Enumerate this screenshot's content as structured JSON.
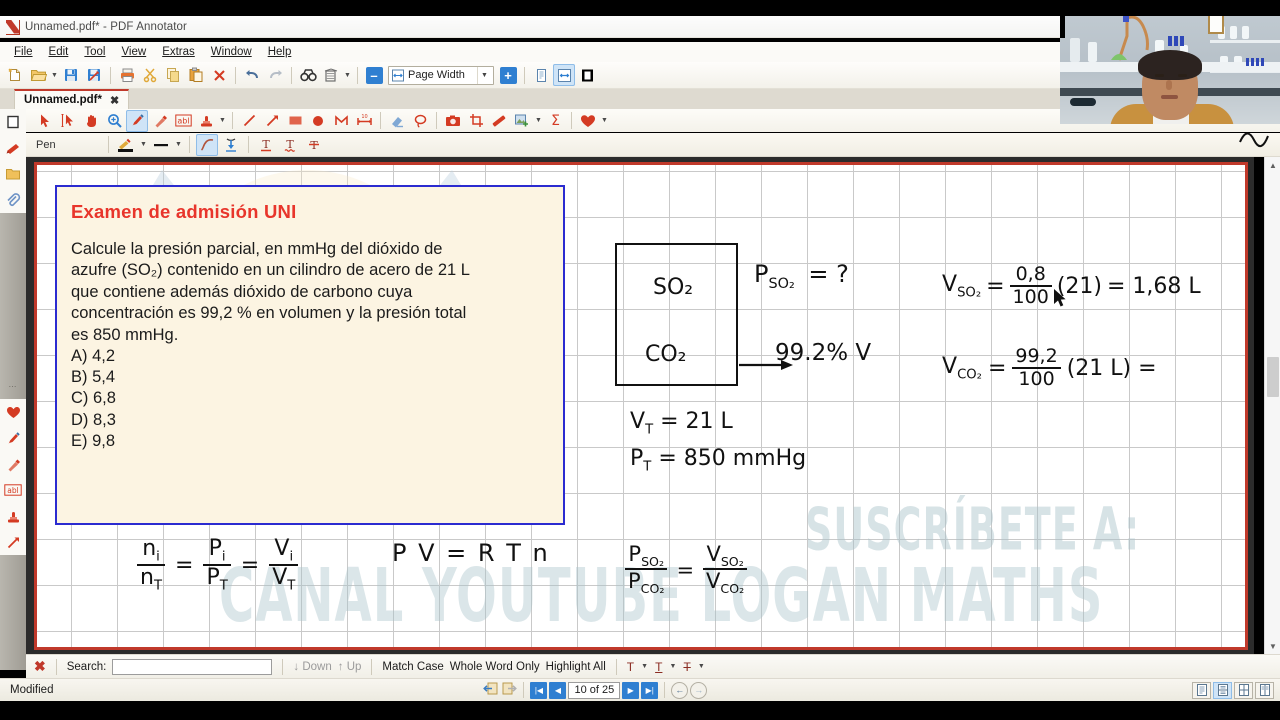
{
  "window": {
    "title": "Unnamed.pdf* - PDF Annotator",
    "logo_icon": "pdf-annotator-logo"
  },
  "menubar": {
    "items": [
      {
        "label": "File"
      },
      {
        "label": "Edit"
      },
      {
        "label": "Tool"
      },
      {
        "label": "View"
      },
      {
        "label": "Extras"
      },
      {
        "label": "Window"
      },
      {
        "label": "Help"
      }
    ]
  },
  "toolbar_main": {
    "zoom_value": "Page Width",
    "buttons": [
      {
        "name": "new-document",
        "icon": "new-page-icon"
      },
      {
        "name": "open-document",
        "icon": "open-folder-icon"
      },
      {
        "name": "save-document",
        "icon": "save-disk-icon"
      },
      {
        "name": "save-as-document",
        "icon": "save-as-icon"
      },
      {
        "name": "print",
        "icon": "printer-icon"
      },
      {
        "name": "cut",
        "icon": "scissors-icon"
      },
      {
        "name": "copy",
        "icon": "copy-icon"
      },
      {
        "name": "paste",
        "icon": "paste-icon"
      },
      {
        "name": "delete",
        "icon": "close-x-icon"
      },
      {
        "name": "undo",
        "icon": "undo-arrow-icon"
      },
      {
        "name": "redo",
        "icon": "redo-arrow-icon"
      },
      {
        "name": "find",
        "icon": "binoculars-icon"
      },
      {
        "name": "page-tools",
        "icon": "page-tools-icon"
      },
      {
        "name": "zoom-out",
        "icon": "minus-icon"
      },
      {
        "name": "zoom-in",
        "icon": "plus-icon"
      },
      {
        "name": "single-page-view",
        "icon": "single-page-icon"
      },
      {
        "name": "fit-width-view",
        "icon": "fit-width-icon"
      },
      {
        "name": "full-screen-view",
        "icon": "full-screen-icon"
      }
    ]
  },
  "tabs": [
    {
      "label": "Unnamed.pdf*",
      "close": "✖",
      "active": true
    }
  ],
  "toolbar_annotate": {
    "pen_label": "Pen",
    "tools": [
      {
        "name": "select-tool",
        "icon": "cursor-arrow-icon"
      },
      {
        "name": "object-select-tool",
        "icon": "object-select-icon"
      },
      {
        "name": "pan-tool",
        "icon": "hand-icon"
      },
      {
        "name": "zoom-tool",
        "icon": "magnifier-icon"
      },
      {
        "name": "pen-tool",
        "icon": "pen-icon",
        "active": true
      },
      {
        "name": "highlighter-tool",
        "icon": "highlighter-icon"
      },
      {
        "name": "text-tool",
        "icon": "abl-text-icon"
      },
      {
        "name": "stamp-tool",
        "icon": "stamp-icon"
      },
      {
        "name": "line-tool",
        "icon": "line-icon"
      },
      {
        "name": "arrow-tool",
        "icon": "arrow-icon"
      },
      {
        "name": "rectangle-tool",
        "icon": "rectangle-icon"
      },
      {
        "name": "ellipse-tool",
        "icon": "filled-circle-icon"
      },
      {
        "name": "polyline-tool",
        "icon": "polyline-icon"
      },
      {
        "name": "measure-tool",
        "icon": "measure-icon"
      },
      {
        "name": "eraser-tool",
        "icon": "eraser-icon"
      },
      {
        "name": "lasso-tool",
        "icon": "lasso-icon"
      },
      {
        "name": "snapshot-tool",
        "icon": "camera-icon"
      },
      {
        "name": "crop-tool",
        "icon": "crop-icon"
      },
      {
        "name": "ruler-tool",
        "icon": "ruler-icon"
      },
      {
        "name": "image-tool",
        "icon": "insert-image-icon"
      },
      {
        "name": "formula-tool",
        "icon": "sigma-icon"
      },
      {
        "name": "favorites-tool",
        "icon": "heart-icon"
      }
    ],
    "pen_options": [
      {
        "name": "pen-color",
        "icon": "pen-color-icon"
      },
      {
        "name": "pen-width",
        "icon": "pen-width-icon"
      },
      {
        "name": "smooth-stroke",
        "icon": "smooth-curve-icon"
      },
      {
        "name": "pressure-stroke",
        "icon": "pressure-icon"
      },
      {
        "name": "text-underline",
        "icon": "text-underline-icon"
      },
      {
        "name": "text-squiggly",
        "icon": "text-squiggly-icon"
      },
      {
        "name": "text-strikeout",
        "icon": "text-strikeout-icon"
      }
    ]
  },
  "left_sidebar": {
    "items": [
      {
        "name": "page-thumbnail",
        "icon": "page-outline-icon"
      },
      {
        "name": "bookmark",
        "icon": "red-bookmark-icon"
      },
      {
        "name": "folder",
        "icon": "yellow-folder-icon"
      },
      {
        "name": "attachment",
        "icon": "paperclip-icon"
      },
      {
        "name": "favorites",
        "icon": "red-heart-icon"
      },
      {
        "name": "pen-favorite",
        "icon": "blue-pen-icon"
      },
      {
        "name": "pencil-favorite",
        "icon": "red-pencil-icon"
      },
      {
        "name": "text-favorite",
        "icon": "abl-text-icon"
      },
      {
        "name": "stamp-favorite",
        "icon": "stamp-icon"
      },
      {
        "name": "arrow-favorite",
        "icon": "red-arrow-icon"
      }
    ]
  },
  "document": {
    "question_box": {
      "title": "Examen de admisión UNI",
      "paragraph_lines": [
        "Calcule la presión parcial, en mmHg del dióxido de",
        "azufre (SO₂) contenido en un cilindro de acero de 21 L",
        "que contiene además dióxido de carbono cuya",
        "concentración es 99,2 % en volumen y la presión total",
        "es 850 mmHg."
      ],
      "options": [
        "A) 4,2",
        "B) 5,4",
        "C) 6,8",
        "D) 8,3",
        "E) 9,8"
      ],
      "title_color": "#e8352b",
      "border_color": "#2b2bd0",
      "fill_color": "#fcf4e2"
    },
    "handwriting": {
      "box_gas_1": "SO₂",
      "box_gas_2": "CO₂",
      "label_arrow_target": "99.2% V",
      "unknown_pressure": "P",
      "unknown_pressure_sub": "SO₂",
      "unknown_pressure_value": "= ?",
      "vt_line": "V",
      "vt_sub": "T",
      "vt_value": "= 21 L",
      "pt_line": "P",
      "pt_sub": "T",
      "pt_value": "= 850 mmHg",
      "vso2_label": "V",
      "vso2_sub": "SO₂",
      "vso2_num": "0,8",
      "vso2_den": "100",
      "vso2_factor": "(21)",
      "vso2_result": "= 1,68 L",
      "vco2_label": "V",
      "vco2_sub": "CO₂",
      "vco2_num": "99,2",
      "vco2_den": "100",
      "vco2_factor": "(21 L) =",
      "ratio_n_num": "n",
      "ratio_n_num_sub": "i",
      "ratio_n_den": "n",
      "ratio_n_den_sub": "T",
      "ratio_p_num": "P",
      "ratio_p_num_sub": "i",
      "ratio_p_den": "P",
      "ratio_p_den_sub": "T",
      "ratio_v_num": "V",
      "ratio_v_num_sub": "i",
      "ratio_v_den": "V",
      "ratio_v_den_sub": "T",
      "gas_law": "P V = R T n",
      "final_p_num": "P",
      "final_p_num_sub": "SO₂",
      "final_p_den": "P",
      "final_p_den_sub": "CO₂",
      "final_v_num": "V",
      "final_v_num_sub": "SO₂",
      "final_v_den": "V",
      "final_v_den_sub": "CO₂",
      "equals": "=",
      "ink_color": "#111111"
    },
    "watermark": {
      "line1": "SUSCRÍBETE A:",
      "line2": "CANAL YOUTUBE LOGAN MATHS",
      "color": "#a8c2c9"
    },
    "page_border_color": "#c0392b"
  },
  "searchbar": {
    "close_icon": "close-search-icon",
    "label": "Search:",
    "input_value": "",
    "input_placeholder": "",
    "down_label": "Down",
    "up_label": "Up",
    "match_case_label": "Match Case",
    "whole_word_label": "Whole Word Only",
    "highlight_all_label": "Highlight All",
    "text_tools": [
      "T",
      "T",
      "T"
    ]
  },
  "statusbar": {
    "status_text": "Modified",
    "page_indicator": "10 of 25",
    "nav": {
      "first_icon": "first-page-icon",
      "prev_icon": "previous-page-icon",
      "next_icon": "next-page-icon",
      "last_icon": "last-page-icon",
      "back_icon": "go-back-icon",
      "forward_icon": "go-forward-icon",
      "import_icon": "import-page-icon",
      "export_icon": "export-page-icon"
    },
    "layout_buttons": [
      {
        "name": "layout-single-page",
        "icon": "single-page-layout-icon",
        "selected": false
      },
      {
        "name": "layout-continuous",
        "icon": "continuous-layout-icon",
        "selected": true
      },
      {
        "name": "layout-grid",
        "icon": "grid-layout-icon",
        "selected": false
      },
      {
        "name": "layout-two-page",
        "icon": "two-page-layout-icon",
        "selected": false
      }
    ]
  },
  "webcam": {
    "name": "presenter-webcam-overlay",
    "scene": "laboratory background with presenter"
  },
  "scrollbar": {
    "up_icon": "scroll-up-icon",
    "down_icon": "scroll-down-icon"
  }
}
